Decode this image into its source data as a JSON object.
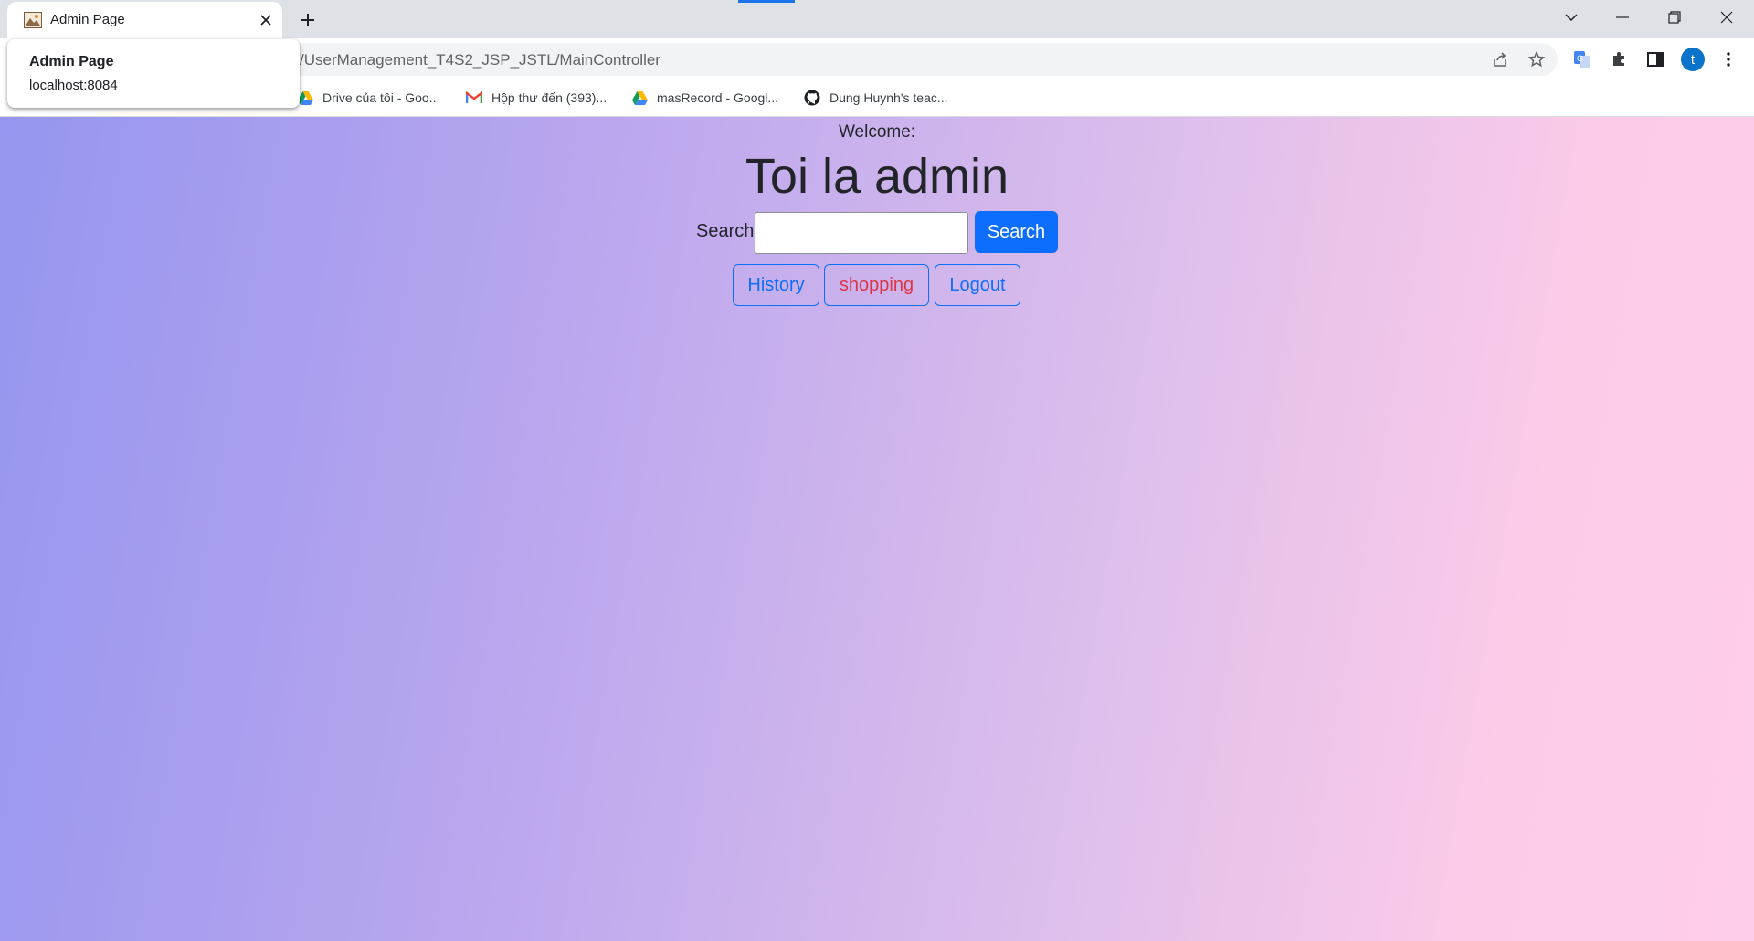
{
  "browser": {
    "tab": {
      "title": "Admin Page"
    },
    "address_bar": {
      "url": "/UserManagement_T4S2_JSP_JSTL/MainController"
    },
    "hover_card": {
      "title": "Admin Page",
      "domain": "localhost:8084"
    },
    "bookmarks": [
      {
        "label": "Drive của tôi - Goo...",
        "icon": "google-drive-icon"
      },
      {
        "label": "Hộp thư đến (393)...",
        "icon": "gmail-icon"
      },
      {
        "label": "masRecord - Googl...",
        "icon": "google-drive-icon"
      },
      {
        "label": "Dung Huynh's teac...",
        "icon": "github-icon"
      }
    ],
    "profile_initial": "t"
  },
  "page": {
    "welcome": "Welcome:",
    "heading": "Toi la admin",
    "search": {
      "label": "Search",
      "value": "",
      "button": "Search"
    },
    "actions": {
      "history": "History",
      "shopping": "shopping",
      "logout": "Logout"
    }
  },
  "colors": {
    "primary": "#0d6efd",
    "danger": "#dc3545",
    "gradient_start": "#9596ef",
    "gradient_end": "#fecde9"
  }
}
